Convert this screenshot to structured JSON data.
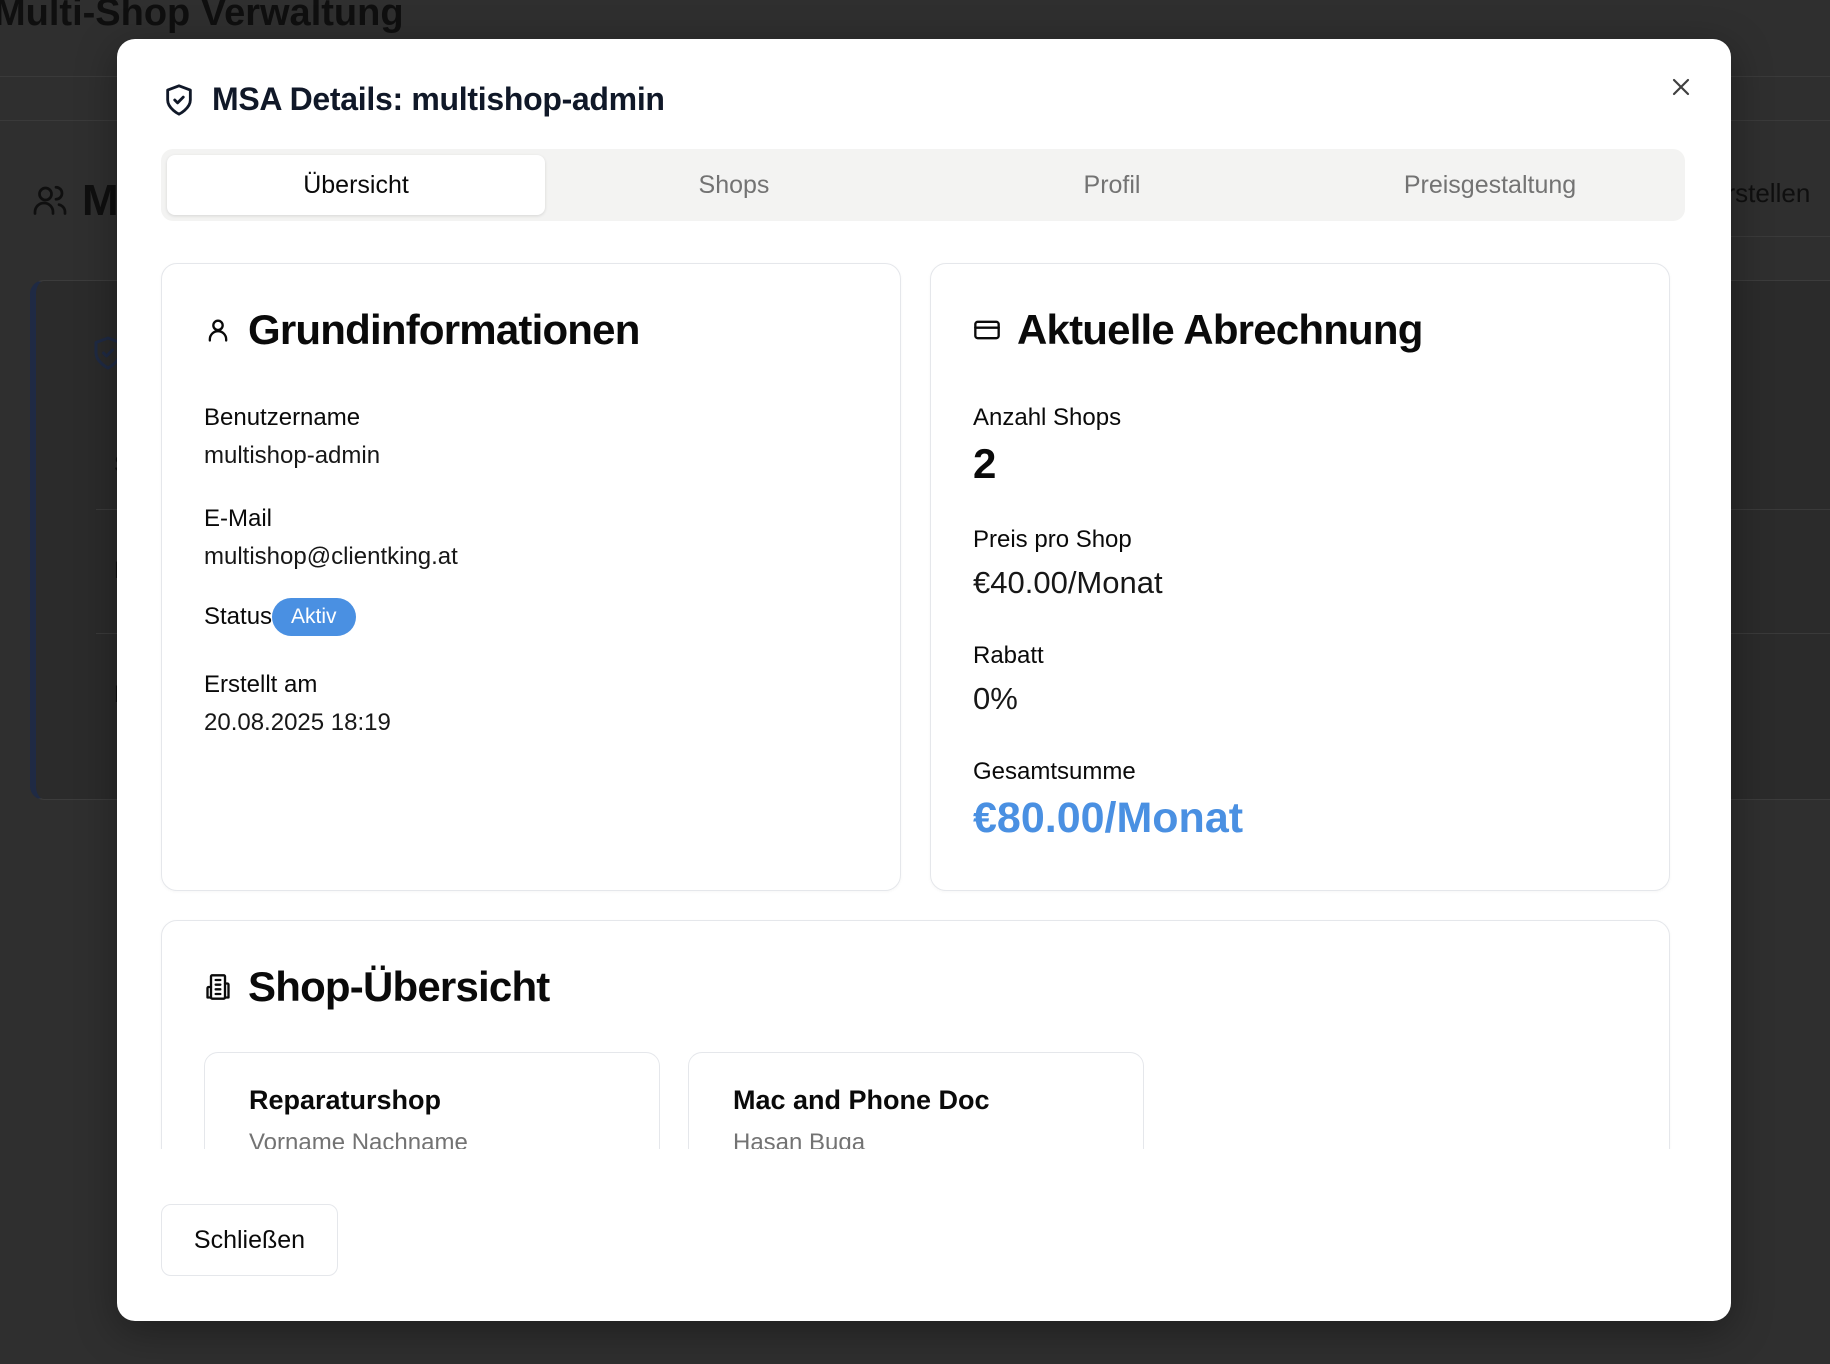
{
  "background": {
    "page_title": "Multi-Shop Verwaltung",
    "section_title_partial": "M",
    "create_button_partial": "erstellen",
    "row_letters": [
      "S",
      "P",
      "N"
    ]
  },
  "modal": {
    "title": "MSA Details: multishop-admin",
    "close_icon": "x-icon",
    "tabs": [
      {
        "label": "Übersicht",
        "active": true
      },
      {
        "label": "Shops",
        "active": false
      },
      {
        "label": "Profil",
        "active": false
      },
      {
        "label": "Preisgestaltung",
        "active": false
      }
    ],
    "basic_info": {
      "title": "Grundinformationen",
      "icon": "user-icon",
      "username_label": "Benutzername",
      "username_value": "multishop-admin",
      "email_label": "E-Mail",
      "email_value": "multishop@clientking.at",
      "status_label": "Status",
      "status_value": "Aktiv",
      "created_label": "Erstellt am",
      "created_value": "20.08.2025 18:19"
    },
    "billing": {
      "title": "Aktuelle Abrechnung",
      "icon": "credit-card-icon",
      "shop_count_label": "Anzahl Shops",
      "shop_count_value": "2",
      "price_label": "Preis pro Shop",
      "price_value": "€40.00/Monat",
      "discount_label": "Rabatt",
      "discount_value": "0%",
      "total_label": "Gesamtsumme",
      "total_value": "€80.00/Monat"
    },
    "shop_overview": {
      "title": "Shop-Übersicht",
      "icon": "building-icon",
      "shops": [
        {
          "name": "Reparaturshop",
          "owner": "Vorname Nachname"
        },
        {
          "name": "Mac and Phone Doc",
          "owner": "Hasan Buga"
        }
      ]
    },
    "close_button_label": "Schließen"
  },
  "colors": {
    "accent": "#4a90e2",
    "badge": "#4a90e2",
    "overlay": "#2f2f2f"
  }
}
